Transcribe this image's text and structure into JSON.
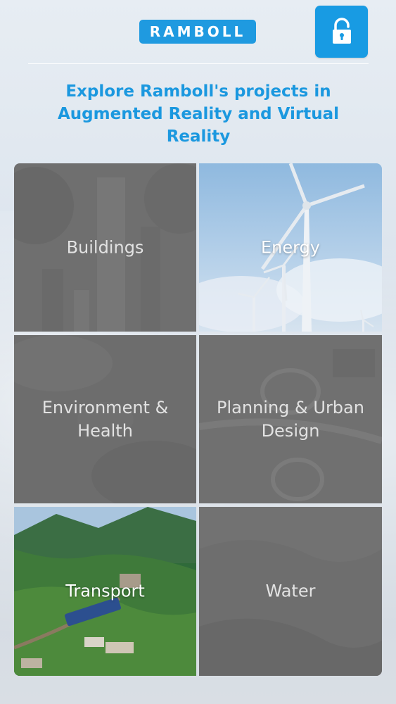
{
  "header": {
    "logo_text": "RAMBOLL",
    "lock_icon": "lock-open-icon",
    "headline": "Explore Ramboll's projects in Augmented Reality and Virtual Reality"
  },
  "colors": {
    "brand_blue": "#1b98df",
    "tile_overlay": "#6e6e6e",
    "label_text": "#e2e2e2"
  },
  "categories": [
    {
      "label": "Buildings"
    },
    {
      "label": "Energy"
    },
    {
      "label": "Environment &\nHealth"
    },
    {
      "label": "Planning & Urban\nDesign"
    },
    {
      "label": "Transport"
    },
    {
      "label": "Water"
    }
  ]
}
